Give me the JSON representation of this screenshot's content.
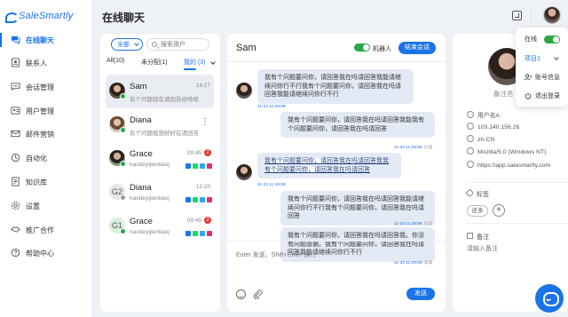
{
  "app": {
    "logo_text": "SaleSmartly",
    "page_title": "在线聊天"
  },
  "sidebar": {
    "items": [
      {
        "label": "在线聊天",
        "icon": "chat-icon",
        "active": true
      },
      {
        "label": "联系人",
        "icon": "contacts-icon"
      },
      {
        "label": "会话管理",
        "icon": "session-icon"
      },
      {
        "label": "用户管理",
        "icon": "users-icon"
      },
      {
        "label": "邮件营销",
        "icon": "mail-icon"
      },
      {
        "label": "自动化",
        "icon": "automation-icon"
      },
      {
        "label": "知识库",
        "icon": "knowledge-icon"
      },
      {
        "label": "设置",
        "icon": "settings-icon"
      },
      {
        "label": "推广合作",
        "icon": "handshake-icon"
      },
      {
        "label": "帮助中心",
        "icon": "help-icon"
      }
    ]
  },
  "list": {
    "filter_value": "全部",
    "search_placeholder": "搜索用户",
    "tabs": [
      {
        "label": "All(10)"
      },
      {
        "label": "未分配(1)"
      },
      {
        "label": "我的 (3)",
        "active": true
      }
    ],
    "conversations": [
      {
        "name": "Sam",
        "preview": "有个问题现在请回答给哈哈",
        "time": "14:27",
        "selected": true
      },
      {
        "name": "Diana",
        "preview": "有个问题我想好好在请回答",
        "more": "⋮"
      },
      {
        "name": "Grace",
        "preview": "haodeyijientiaoj",
        "time": "09:45",
        "badge": "2"
      },
      {
        "name": "Diana",
        "preview": "haodeyijientiaoj",
        "time": "12:20",
        "avatar_letter": "G2"
      },
      {
        "name": "Grace",
        "preview": "haodeyijientiaoj",
        "time": "09:45",
        "badge": "2",
        "avatar_letter": "G1"
      }
    ]
  },
  "chat": {
    "contact_name": "Sam",
    "bot_label": "机器人",
    "bot_on": true,
    "end_label": "结束会话",
    "messages": [
      {
        "dir": "in",
        "text": "我有个问题要问你，请回答我在吗请回答我能请继续问你行不行我有个问题要问你，请回答我在吗请回答我能请继续问你行不行",
        "meta": "11-23 11:29:08"
      },
      {
        "dir": "out",
        "text": "我有个问题要问你，请回答我在吗请回答我能我有个问题要问你，请回答我在吗请回答",
        "meta": "11-23 11:29:08",
        "status": "已读"
      },
      {
        "dir": "in",
        "text": "我有个问题要问你，请回答我在吗请回答我我有个问题要问你，请回答我在吗请回答",
        "meta": "11-23 11:29:08",
        "selected": true
      },
      {
        "dir": "out",
        "text": "我有个问题要问你，请回答我在吗请回答我能请继续问你行不行我有个问题要问你，请回答我在吗请回答",
        "meta": "11-23 11:29:08",
        "status": "已读"
      },
      {
        "dir": "out",
        "text": "我有个问题要问你，请回答我在吗请回答我。你没有问题感谢。我有个问题要问你，请回答我在吗请回答我能请继续问你行不行",
        "meta": "11-23 11:29:08",
        "status": "未读"
      }
    ],
    "input_placeholder": "Enter 发送，Shift+Enter 换行",
    "send_label": "发送"
  },
  "info": {
    "note": "备注名",
    "rows": [
      {
        "icon": "user-icon",
        "value": "用户名A"
      },
      {
        "icon": "ip-icon",
        "value": "103.140.156.26"
      },
      {
        "icon": "language-icon",
        "value": "zh-CN"
      },
      {
        "icon": "browser-icon",
        "value": "Mozilla/5.0 (Windows NT)"
      },
      {
        "icon": "link-icon",
        "value": "https://app.salesmartly.com"
      }
    ],
    "tags_label": "标签",
    "add_tag_label": "还多",
    "remark_label": "备注",
    "remark_placeholder": "请输入备注"
  },
  "dropdown": {
    "status_label": "在线",
    "status_on": true,
    "project_label": "项目1",
    "account_label": "账号信息",
    "logout_label": "退出登录"
  },
  "colors": {
    "primary": "#1a73e8",
    "online": "#28a745",
    "badge": "#e53935"
  }
}
